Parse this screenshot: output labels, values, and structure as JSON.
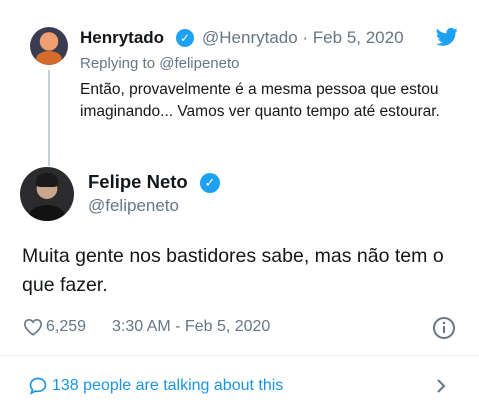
{
  "reply_tweet": {
    "author_name": "Henrytado",
    "author_handle": "@Henrytado · Feb 5, 2020",
    "replying_to": "Replying to @felipeneto",
    "text": "Então, provavelmente é a mesma pessoa que estou imaginando... Vamos ver quanto tempo até estourar."
  },
  "main_tweet": {
    "author_name": "Felipe Neto",
    "author_handle": "@felipeneto",
    "text": "Muita gente nos bastidores sabe, mas não tem o que fazer.",
    "like_count": "6,259",
    "timestamp": "3:30 AM - Feb 5, 2020"
  },
  "footer": {
    "talking_link": "138 people are talking about this"
  },
  "colors": {
    "brand_blue": "#1da1f2",
    "link_blue": "#1b95e0",
    "secondary_text": "#657786"
  },
  "icons": [
    "verified-icon",
    "twitter-bird-icon",
    "heart-icon",
    "info-icon",
    "comment-icon",
    "chevron-right-icon"
  ]
}
